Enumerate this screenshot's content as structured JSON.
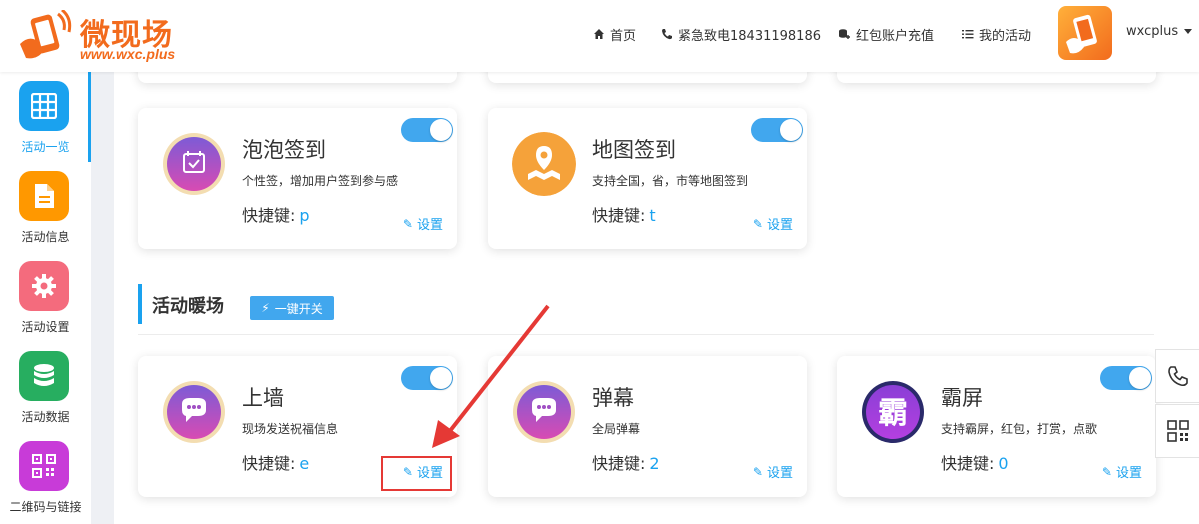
{
  "header": {
    "logo_title": "微现场",
    "logo_url": "www.wxc.plus",
    "nav": [
      {
        "icon": "home-icon",
        "label": "首页"
      },
      {
        "icon": "phone-icon",
        "label": "紧急致电18431198186"
      },
      {
        "icon": "coins-icon",
        "label": "红包账户充值"
      },
      {
        "icon": "list-icon",
        "label": "我的活动"
      }
    ],
    "username": "wxcplus"
  },
  "sidebar": {
    "items": [
      {
        "label": "活动一览",
        "icon": "grid-icon",
        "color": "#1aa2ef",
        "active": true
      },
      {
        "label": "活动信息",
        "icon": "document-icon",
        "color": "#ff9800",
        "active": false
      },
      {
        "label": "活动设置",
        "icon": "gear-icon",
        "color": "#f46b7d",
        "active": false
      },
      {
        "label": "活动数据",
        "icon": "database-icon",
        "color": "#27ae60",
        "active": false
      },
      {
        "label": "二维码与链接",
        "icon": "qrcode-icon",
        "color": "#c83bd8",
        "active": false
      }
    ]
  },
  "cards_row1": [
    {
      "title": "泡泡签到",
      "desc": "个性签，增加用户签到参与感",
      "key_label": "快捷键:",
      "key": "p",
      "settings": "设置",
      "toggle_on": true
    },
    {
      "title": "地图签到",
      "desc": "支持全国，省，市等地图签到",
      "key_label": "快捷键:",
      "key": "t",
      "settings": "设置",
      "toggle_on": true
    }
  ],
  "section": {
    "title": "活动暖场",
    "button": "一键开关"
  },
  "cards_row2": [
    {
      "title": "上墙",
      "desc": "现场发送祝福信息",
      "key_label": "快捷键:",
      "key": "e",
      "settings": "设置",
      "toggle_on": true
    },
    {
      "title": "弹幕",
      "desc": "全局弹幕",
      "key_label": "快捷键:",
      "key": "2",
      "settings": "设置",
      "toggle_on": false
    },
    {
      "title": "霸屏",
      "desc": "支持霸屏，红包，打赏，点歌",
      "key_label": "快捷键:",
      "key": "0",
      "settings": "设置",
      "toggle_on": true,
      "icon_char": "霸"
    }
  ],
  "colors": {
    "accent": "#1aa2ef",
    "brand": "#f26b1d",
    "highlight": "#e53935"
  }
}
